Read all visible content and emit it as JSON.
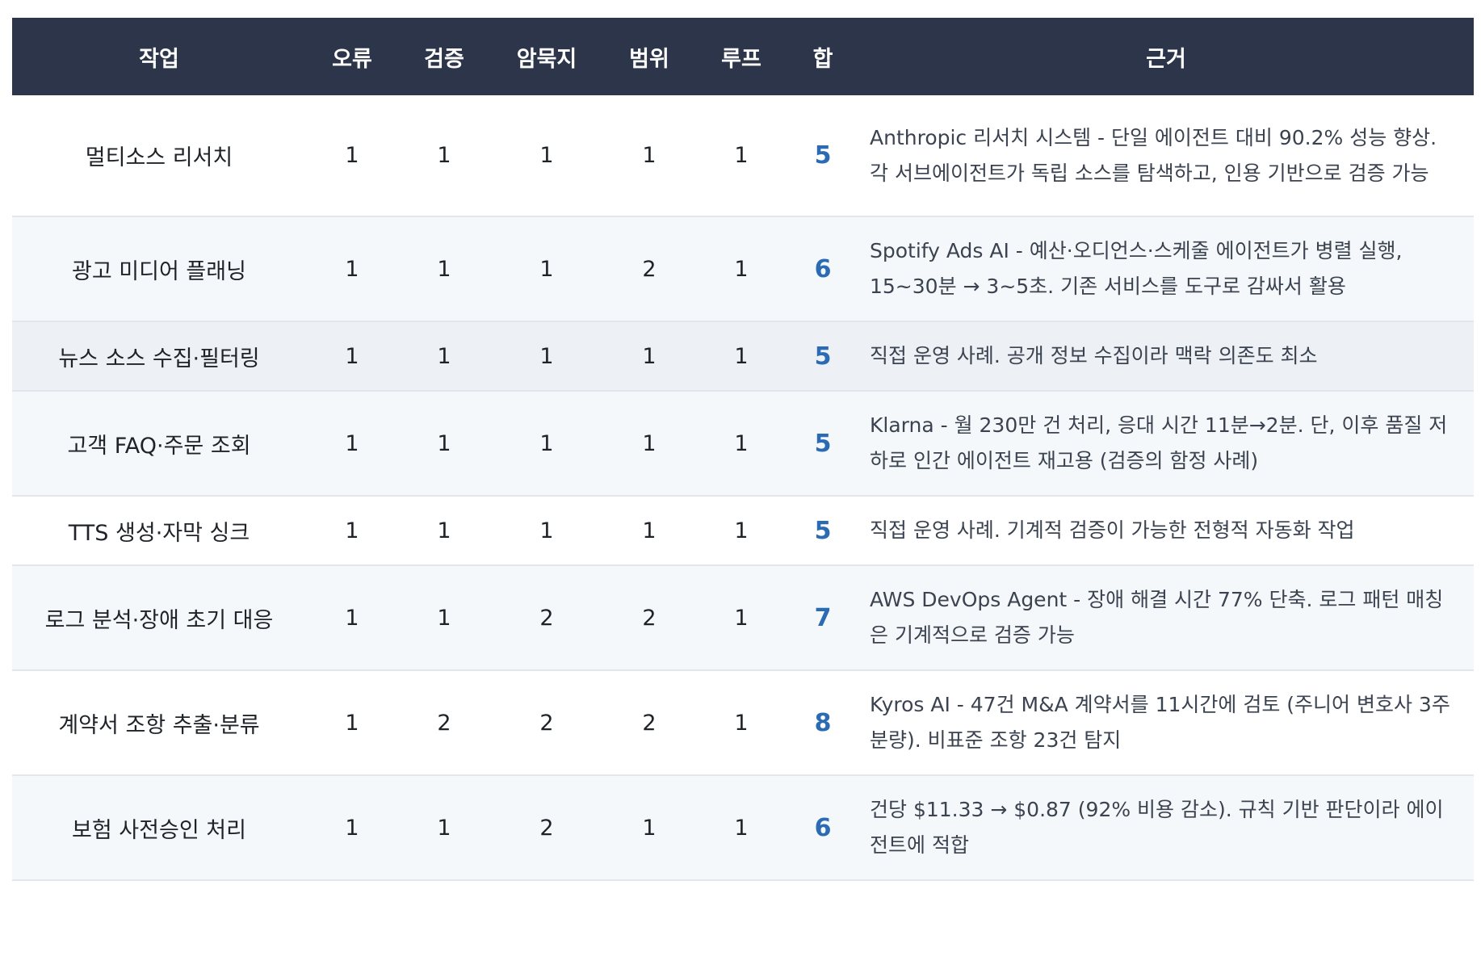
{
  "headers": [
    "작업",
    "오류",
    "검증",
    "암묵지",
    "범위",
    "루프",
    "합",
    "근거"
  ],
  "rows": [
    {
      "task": "멀티소스 리서치",
      "scores": [
        "1",
        "1",
        "1",
        "1",
        "1"
      ],
      "sum": "5",
      "reason": "Anthropic 리서치 시스템 - 단일 에이전트 대비 90.2% 성능 향상. 각 서브에이전트가 독립 소스를 탐색하고, 인용 기반으로 검증 가능"
    },
    {
      "task": "광고 미디어 플래닝",
      "scores": [
        "1",
        "1",
        "1",
        "2",
        "1"
      ],
      "sum": "6",
      "reason": "Spotify Ads AI - 예산·오디언스·스케줄 에이전트가 병렬 실행, 15~30분 → 3~5초. 기존 서비스를 도구로 감싸서 활용"
    },
    {
      "task": "뉴스 소스 수집·필터링",
      "scores": [
        "1",
        "1",
        "1",
        "1",
        "1"
      ],
      "sum": "5",
      "reason": "직접 운영 사례. 공개 정보 수집이라 맥락 의존도 최소"
    },
    {
      "task": "고객 FAQ·주문 조회",
      "scores": [
        "1",
        "1",
        "1",
        "1",
        "1"
      ],
      "sum": "5",
      "reason": "Klarna - 월 230만 건 처리, 응대 시간 11분→2분. 단, 이후 품질 저하로 인간 에이전트 재고용 (검증의 함정 사례)"
    },
    {
      "task": "TTS 생성·자막 싱크",
      "scores": [
        "1",
        "1",
        "1",
        "1",
        "1"
      ],
      "sum": "5",
      "reason": "직접 운영 사례. 기계적 검증이 가능한 전형적 자동화 작업"
    },
    {
      "task": "로그 분석·장애 초기 대응",
      "scores": [
        "1",
        "1",
        "2",
        "2",
        "1"
      ],
      "sum": "7",
      "reason": "AWS DevOps Agent - 장애 해결 시간 77% 단축. 로그 패턴 매칭은 기계적으로 검증 가능"
    },
    {
      "task": "계약서 조항 추출·분류",
      "scores": [
        "1",
        "2",
        "2",
        "2",
        "1"
      ],
      "sum": "8",
      "reason": "Kyros AI - 47건 M&A 계약서를 11시간에 검토 (주니어 변호사 3주 분량). 비표준 조항 23건 탐지"
    },
    {
      "task": "보험 사전승인 처리",
      "scores": [
        "1",
        "1",
        "2",
        "1",
        "1"
      ],
      "sum": "6",
      "reason": "건당 $11.33 → $0.87 (92% 비용 감소). 규칙 기반 판단이라 에이전트에 적합"
    }
  ]
}
